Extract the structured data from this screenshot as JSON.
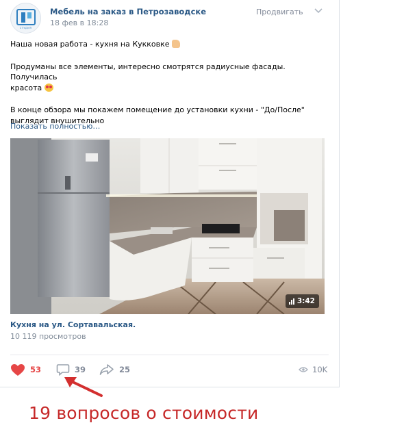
{
  "post": {
    "author": "Мебель на заказ в Петрозаводске",
    "date": "18 фев в 18:28",
    "promote_label": "Продвигать",
    "logo_caption": "СТУДИЯ",
    "text": {
      "line1": "Наша новая работа - кухня на Кукковке",
      "line2": "Продуманы все элементы, интересно смотрятся радиусные фасады. Получилась",
      "line3": "красота",
      "line4": "В конце обзора мы покажем помещение до установки кухни - \"До/После\"",
      "line5": "выглядит внушительно"
    },
    "show_more": "Показать полностью…"
  },
  "video": {
    "duration": "3:42",
    "title": "Кухня на ул. Сортавальская.",
    "views": "10 119 просмотров"
  },
  "actions": {
    "likes": "53",
    "comments": "39",
    "shares": "25",
    "views": "10K"
  },
  "annotation": {
    "text": "19 вопросов о стоимости"
  },
  "colors": {
    "link": "#2a5885",
    "like": "#e64646",
    "muted": "#828a99",
    "annotation": "#c62828"
  }
}
